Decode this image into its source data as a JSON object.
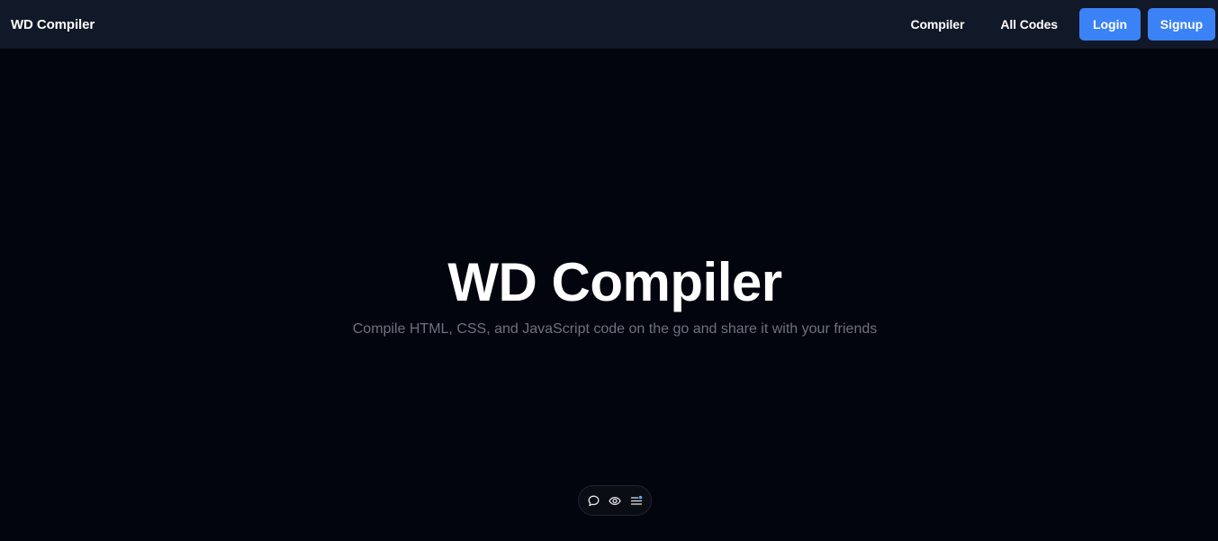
{
  "navbar": {
    "brand": "WD Compiler",
    "links": {
      "compiler": "Compiler",
      "all_codes": "All Codes"
    },
    "buttons": {
      "login": "Login",
      "signup": "Signup"
    }
  },
  "hero": {
    "title": "WD Compiler",
    "subtitle": "Compile HTML, CSS, and JavaScript code on the go and share it with your friends"
  },
  "toolbar": {
    "icons": [
      "comment-icon",
      "eye-icon",
      "menu-list-icon"
    ]
  },
  "colors": {
    "background": "#02050e",
    "navbar": "#111827",
    "accent": "#3b82f6",
    "subtitle": "#6b7280"
  }
}
